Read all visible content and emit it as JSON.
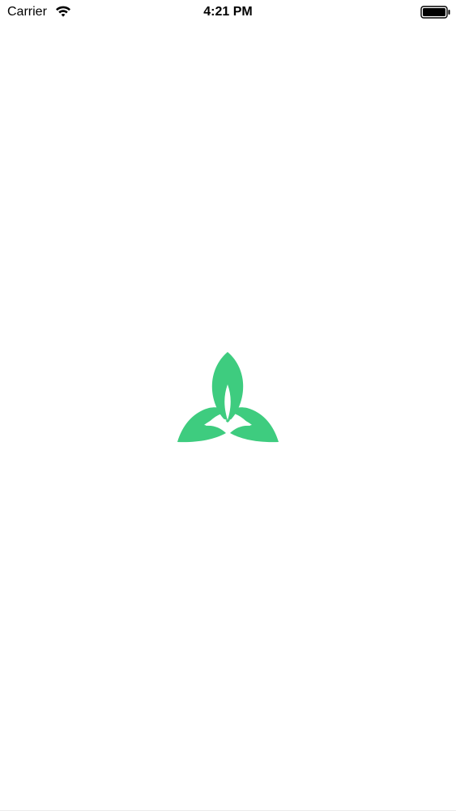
{
  "status_bar": {
    "carrier": "Carrier",
    "time": "4:21 PM",
    "wifi_icon": "wifi-icon",
    "battery_icon": "battery-icon"
  },
  "splash": {
    "logo_icon": "leaf-logo-icon",
    "brand_color": "#3ecc7f"
  }
}
